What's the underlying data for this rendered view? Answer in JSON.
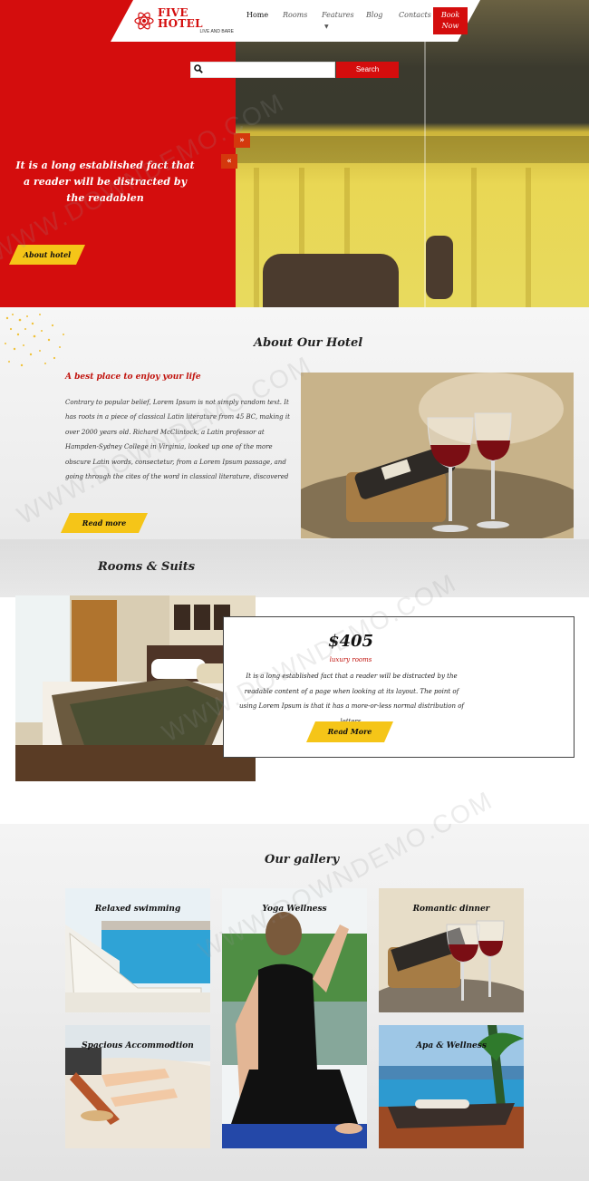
{
  "header": {
    "logo_title": "FIVE HOTEL",
    "logo_sub": "LIVE AND BARE",
    "nav": [
      {
        "label": "Home"
      },
      {
        "label": "Rooms"
      },
      {
        "label": "Features"
      },
      {
        "label": "Blog"
      },
      {
        "label": "Contacts"
      }
    ],
    "book_label_1": "Book",
    "book_label_2": "Now"
  },
  "search": {
    "placeholder": "",
    "button": "Search"
  },
  "hero": {
    "text": "It is a long established fact that a reader will be distracted by the readablen",
    "button": "About hotel",
    "arrow_next": "»",
    "arrow_prev": "«"
  },
  "about": {
    "title": "About Our Hotel",
    "subtitle": "A best place to enjoy your life",
    "body": "Contrary to popular belief, Lorem Ipsum is not simply random text. It has roots in a piece of classical Latin literature from 45 BC, making it over 2000 years old. Richard McClintock, a Latin professor at Hampden-Sydney College in Virginia, looked up one of the more obscure Latin words, consectetur, from a Lorem Ipsum passage, and going through the cites of the word in classical literature, discovered",
    "button": "Read more"
  },
  "rooms": {
    "title": "Rooms & Suits",
    "price": "$405",
    "type": "luxury rooms",
    "desc": "It is a long established fact that a reader will be distracted by the readable content of a page when looking at its layout. The point of using Lorem Ipsum is that it has a more-or-less normal distribution of letters.",
    "button": "Read More"
  },
  "gallery": {
    "title": "Our gallery",
    "items": [
      {
        "label": "Relaxed swimming"
      },
      {
        "label": "Yoga Wellness"
      },
      {
        "label": "Romantic dinner"
      },
      {
        "label": "Spacious Accommodtion"
      },
      {
        "label": "Apa & Wellness"
      }
    ]
  },
  "colors": {
    "brand_red": "#d40d0d",
    "accent_yellow": "#f5c518"
  },
  "watermark": "WWW.DOWNDEMO.COM"
}
